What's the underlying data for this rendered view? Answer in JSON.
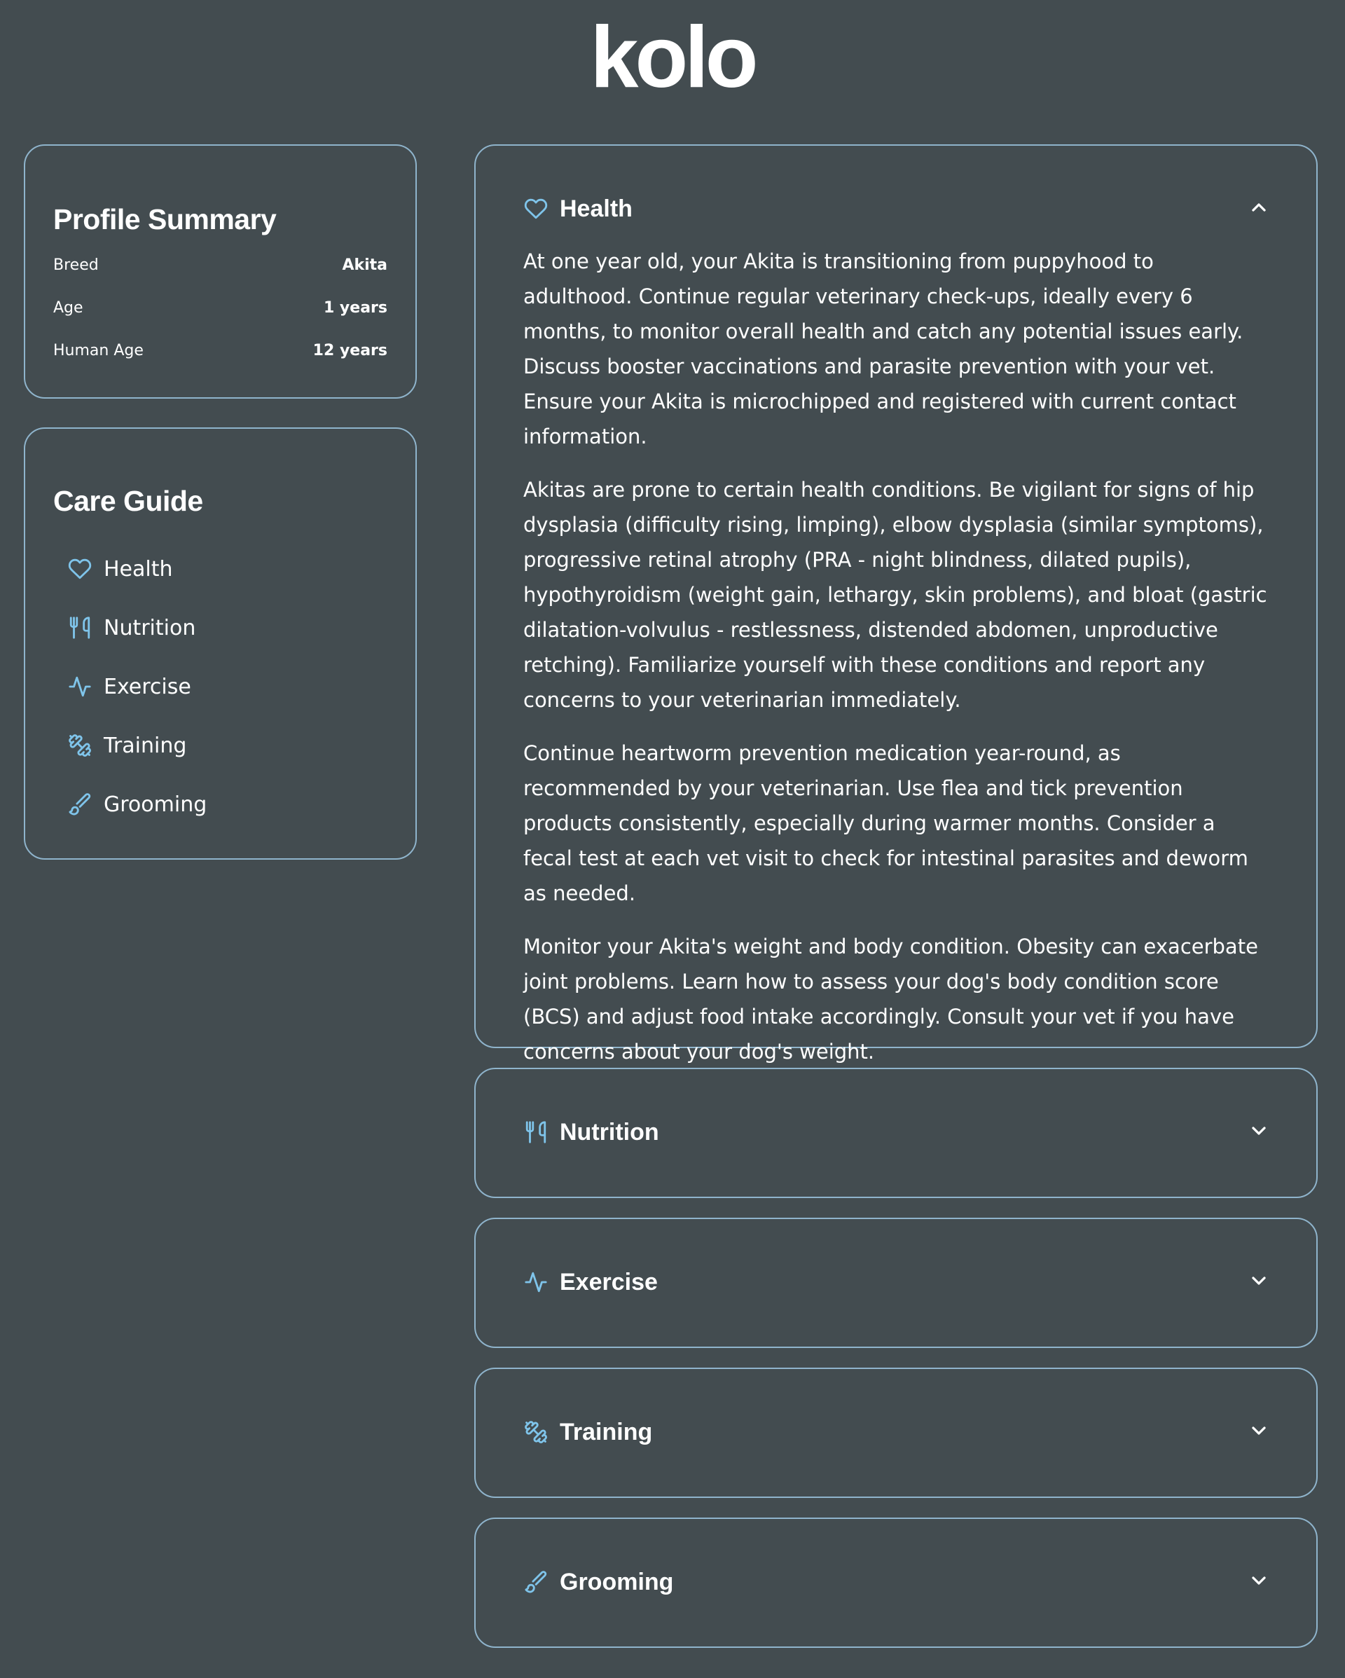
{
  "brand": {
    "logo": "kolo"
  },
  "profile": {
    "title": "Profile Summary",
    "rows": [
      {
        "label": "Breed",
        "value": "Akita"
      },
      {
        "label": "Age",
        "value": "1 years"
      },
      {
        "label": "Human Age",
        "value": "12 years"
      }
    ]
  },
  "care_guide": {
    "title": "Care Guide",
    "items": [
      {
        "label": "Health",
        "icon": "heart-icon"
      },
      {
        "label": "Nutrition",
        "icon": "utensils-icon"
      },
      {
        "label": "Exercise",
        "icon": "activity-icon"
      },
      {
        "label": "Training",
        "icon": "dumbbell-icon"
      },
      {
        "label": "Grooming",
        "icon": "brush-icon"
      }
    ]
  },
  "sections": {
    "health": {
      "title": "Health",
      "expanded": true,
      "paragraphs": [
        "At one year old, your Akita is transitioning from puppyhood to adulthood. Continue regular veterinary check-ups, ideally every 6 months, to monitor overall health and catch any potential issues early. Discuss booster vaccinations and parasite prevention with your vet. Ensure your Akita is microchipped and registered with current contact information.",
        "Akitas are prone to certain health conditions. Be vigilant for signs of hip dysplasia (difficulty rising, limping), elbow dysplasia (similar symptoms), progressive retinal atrophy (PRA - night blindness, dilated pupils), hypothyroidism (weight gain, lethargy, skin problems), and bloat (gastric dilatation-volvulus - restlessness, distended abdomen, unproductive retching). Familiarize yourself with these conditions and report any concerns to your veterinarian immediately.",
        "Continue heartworm prevention medication year-round, as recommended by your veterinarian. Use flea and tick prevention products consistently, especially during warmer months. Consider a fecal test at each vet visit to check for intestinal parasites and deworm as needed.",
        "Monitor your Akita's weight and body condition. Obesity can exacerbate joint problems. Learn how to assess your dog's body condition score (BCS) and adjust food intake accordingly. Consult your vet if you have concerns about your dog's weight."
      ]
    },
    "nutrition": {
      "title": "Nutrition",
      "expanded": false
    },
    "exercise": {
      "title": "Exercise",
      "expanded": false
    },
    "training": {
      "title": "Training",
      "expanded": false
    },
    "grooming": {
      "title": "Grooming",
      "expanded": false
    }
  },
  "colors": {
    "background": "#434c50",
    "border": "#8fb4cc",
    "icon_accent": "#7fc4ea",
    "text": "#ffffff"
  }
}
